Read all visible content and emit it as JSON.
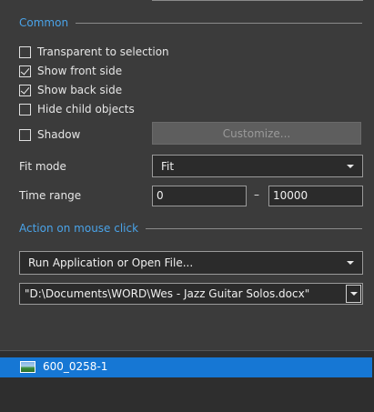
{
  "sections": {
    "common": "Common",
    "action": "Action on mouse click"
  },
  "checkboxes": [
    {
      "label": "Transparent to selection",
      "checked": false
    },
    {
      "label": "Show front side",
      "checked": true
    },
    {
      "label": "Show back side",
      "checked": true
    },
    {
      "label": "Hide child objects",
      "checked": false
    }
  ],
  "shadow": {
    "label": "Shadow",
    "checked": false,
    "customize_label": "Customize..."
  },
  "fit_mode": {
    "label": "Fit mode",
    "value": "Fit"
  },
  "time_range": {
    "label": "Time range",
    "from": "0",
    "separator": "–",
    "to": "10000"
  },
  "action": {
    "value": "Run Application or Open File...",
    "path": "\"D:\\Documents\\WORD\\Wes - Jazz Guitar Solos.docx\""
  },
  "objects_list": {
    "items": [
      {
        "label": "600_0258-1",
        "selected": true,
        "icon": "image-thumbnail-icon"
      }
    ]
  },
  "colors": {
    "accent": "#4aa3e8",
    "selection": "#1677d4",
    "background": "#3b3b3b"
  }
}
